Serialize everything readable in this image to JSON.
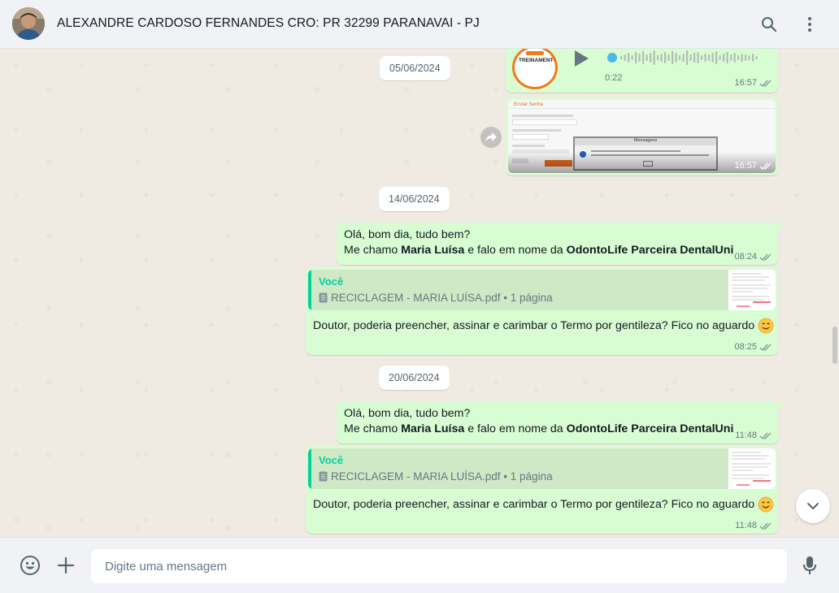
{
  "header": {
    "contact_name": "ALEXANDRE CARDOSO FERNANDES CRO: PR 32299 PARANAVAI - PJ"
  },
  "chat": {
    "dates": [
      "05/06/2024",
      "14/06/2024",
      "20/06/2024"
    ],
    "audio": {
      "duration": "0:22",
      "time": "16:57",
      "thumb_text": "TREINAMENTO"
    },
    "image_msg": {
      "time": "16:57",
      "dialog_title": "Mensagens",
      "form_title": "Enviar Senha"
    },
    "messages": [
      {
        "line1": "Olá, bom dia, tudo bem?",
        "line2_pre": "Me chamo ",
        "line2_bold1": "Maria Luísa",
        "line2_mid": " e falo em nome da ",
        "line2_bold2": "OdontoLife Parceira DentalUni",
        "time": "08:24"
      },
      {
        "quote_author": "Você",
        "quote_file": "RECICLAGEM - MARIA LUÍSA.pdf • 1 página",
        "text": "Doutor, poderia preencher, assinar e carimbar o Termo por gentileza? Fico no aguardo",
        "time": "08:25"
      },
      {
        "line1": "Olá, bom dia, tudo bem?",
        "line2_pre": "Me chamo ",
        "line2_bold1": "Maria Luísa",
        "line2_mid": " e falo em nome da ",
        "line2_bold2": "OdontoLife Parceira DentalUni",
        "time": "11:48"
      },
      {
        "quote_author": "Você",
        "quote_file": "RECICLAGEM - MARIA LUÍSA.pdf • 1 página",
        "text": "Doutor, poderia preencher, assinar e carimbar o Termo por gentileza? Fico no aguardo",
        "time": "11:48"
      }
    ]
  },
  "composer": {
    "placeholder": "Digite uma mensagem"
  },
  "colors": {
    "outgoing_bubble": "#d9fdd3",
    "accent": "#06cf9c",
    "tick": "#8696a0"
  },
  "icons": [
    "search-icon",
    "menu-icon",
    "emoji-icon",
    "attach-icon",
    "mic-icon",
    "chevron-down-icon",
    "forward-icon",
    "play-icon",
    "document-icon",
    "double-check-icon",
    "smile-emoji"
  ]
}
